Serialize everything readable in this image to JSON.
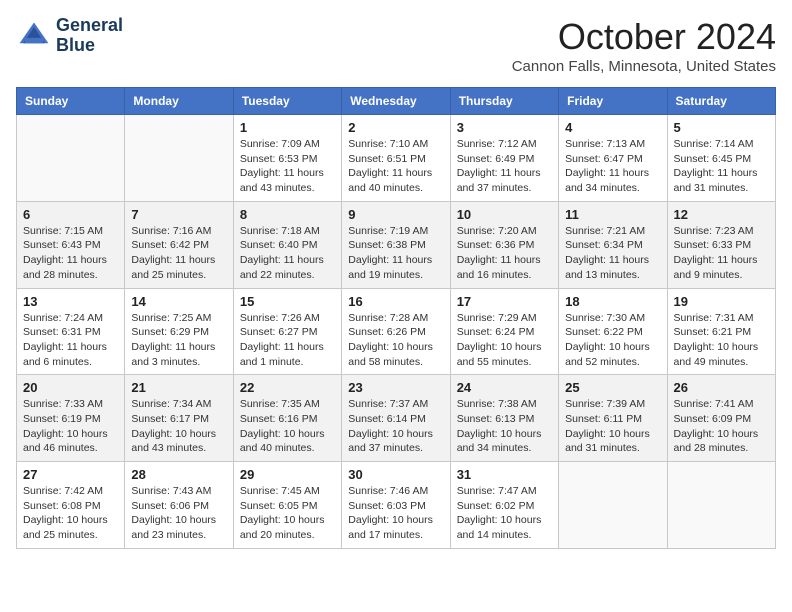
{
  "header": {
    "logo_line1": "General",
    "logo_line2": "Blue",
    "month": "October 2024",
    "location": "Cannon Falls, Minnesota, United States"
  },
  "weekdays": [
    "Sunday",
    "Monday",
    "Tuesday",
    "Wednesday",
    "Thursday",
    "Friday",
    "Saturday"
  ],
  "weeks": [
    [
      {
        "day": "",
        "info": ""
      },
      {
        "day": "",
        "info": ""
      },
      {
        "day": "1",
        "info": "Sunrise: 7:09 AM\nSunset: 6:53 PM\nDaylight: 11 hours and 43 minutes."
      },
      {
        "day": "2",
        "info": "Sunrise: 7:10 AM\nSunset: 6:51 PM\nDaylight: 11 hours and 40 minutes."
      },
      {
        "day": "3",
        "info": "Sunrise: 7:12 AM\nSunset: 6:49 PM\nDaylight: 11 hours and 37 minutes."
      },
      {
        "day": "4",
        "info": "Sunrise: 7:13 AM\nSunset: 6:47 PM\nDaylight: 11 hours and 34 minutes."
      },
      {
        "day": "5",
        "info": "Sunrise: 7:14 AM\nSunset: 6:45 PM\nDaylight: 11 hours and 31 minutes."
      }
    ],
    [
      {
        "day": "6",
        "info": "Sunrise: 7:15 AM\nSunset: 6:43 PM\nDaylight: 11 hours and 28 minutes."
      },
      {
        "day": "7",
        "info": "Sunrise: 7:16 AM\nSunset: 6:42 PM\nDaylight: 11 hours and 25 minutes."
      },
      {
        "day": "8",
        "info": "Sunrise: 7:18 AM\nSunset: 6:40 PM\nDaylight: 11 hours and 22 minutes."
      },
      {
        "day": "9",
        "info": "Sunrise: 7:19 AM\nSunset: 6:38 PM\nDaylight: 11 hours and 19 minutes."
      },
      {
        "day": "10",
        "info": "Sunrise: 7:20 AM\nSunset: 6:36 PM\nDaylight: 11 hours and 16 minutes."
      },
      {
        "day": "11",
        "info": "Sunrise: 7:21 AM\nSunset: 6:34 PM\nDaylight: 11 hours and 13 minutes."
      },
      {
        "day": "12",
        "info": "Sunrise: 7:23 AM\nSunset: 6:33 PM\nDaylight: 11 hours and 9 minutes."
      }
    ],
    [
      {
        "day": "13",
        "info": "Sunrise: 7:24 AM\nSunset: 6:31 PM\nDaylight: 11 hours and 6 minutes."
      },
      {
        "day": "14",
        "info": "Sunrise: 7:25 AM\nSunset: 6:29 PM\nDaylight: 11 hours and 3 minutes."
      },
      {
        "day": "15",
        "info": "Sunrise: 7:26 AM\nSunset: 6:27 PM\nDaylight: 11 hours and 1 minute."
      },
      {
        "day": "16",
        "info": "Sunrise: 7:28 AM\nSunset: 6:26 PM\nDaylight: 10 hours and 58 minutes."
      },
      {
        "day": "17",
        "info": "Sunrise: 7:29 AM\nSunset: 6:24 PM\nDaylight: 10 hours and 55 minutes."
      },
      {
        "day": "18",
        "info": "Sunrise: 7:30 AM\nSunset: 6:22 PM\nDaylight: 10 hours and 52 minutes."
      },
      {
        "day": "19",
        "info": "Sunrise: 7:31 AM\nSunset: 6:21 PM\nDaylight: 10 hours and 49 minutes."
      }
    ],
    [
      {
        "day": "20",
        "info": "Sunrise: 7:33 AM\nSunset: 6:19 PM\nDaylight: 10 hours and 46 minutes."
      },
      {
        "day": "21",
        "info": "Sunrise: 7:34 AM\nSunset: 6:17 PM\nDaylight: 10 hours and 43 minutes."
      },
      {
        "day": "22",
        "info": "Sunrise: 7:35 AM\nSunset: 6:16 PM\nDaylight: 10 hours and 40 minutes."
      },
      {
        "day": "23",
        "info": "Sunrise: 7:37 AM\nSunset: 6:14 PM\nDaylight: 10 hours and 37 minutes."
      },
      {
        "day": "24",
        "info": "Sunrise: 7:38 AM\nSunset: 6:13 PM\nDaylight: 10 hours and 34 minutes."
      },
      {
        "day": "25",
        "info": "Sunrise: 7:39 AM\nSunset: 6:11 PM\nDaylight: 10 hours and 31 minutes."
      },
      {
        "day": "26",
        "info": "Sunrise: 7:41 AM\nSunset: 6:09 PM\nDaylight: 10 hours and 28 minutes."
      }
    ],
    [
      {
        "day": "27",
        "info": "Sunrise: 7:42 AM\nSunset: 6:08 PM\nDaylight: 10 hours and 25 minutes."
      },
      {
        "day": "28",
        "info": "Sunrise: 7:43 AM\nSunset: 6:06 PM\nDaylight: 10 hours and 23 minutes."
      },
      {
        "day": "29",
        "info": "Sunrise: 7:45 AM\nSunset: 6:05 PM\nDaylight: 10 hours and 20 minutes."
      },
      {
        "day": "30",
        "info": "Sunrise: 7:46 AM\nSunset: 6:03 PM\nDaylight: 10 hours and 17 minutes."
      },
      {
        "day": "31",
        "info": "Sunrise: 7:47 AM\nSunset: 6:02 PM\nDaylight: 10 hours and 14 minutes."
      },
      {
        "day": "",
        "info": ""
      },
      {
        "day": "",
        "info": ""
      }
    ]
  ]
}
